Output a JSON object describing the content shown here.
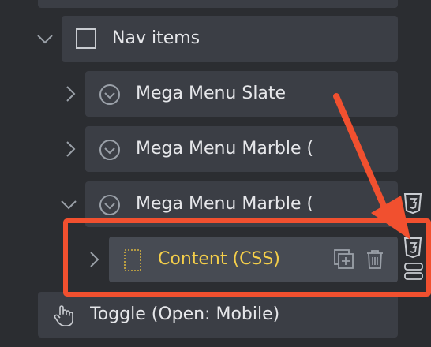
{
  "tree": {
    "nav_items": {
      "label": "Nav items"
    },
    "mega_menu_slate": {
      "label": "Mega Menu Slate"
    },
    "mega_menu_marble_1": {
      "label": "Mega Menu Marble ("
    },
    "mega_menu_marble_2": {
      "label": "Mega Menu Marble ("
    },
    "content_css": {
      "label": "Content (CSS)"
    },
    "toggle": {
      "label": "Toggle (Open: Mobile)"
    }
  },
  "colors": {
    "background": "#2b2d31",
    "row": "#3b3e45",
    "row_selected": "#474b53",
    "highlight_label": "#f5cf4a",
    "annotation": "#f1502f"
  },
  "icons": [
    "chevron-right-icon",
    "chevron-down-icon",
    "checkbox-icon",
    "circle-chevron-icon",
    "dotted-frame-icon",
    "duplicate-icon",
    "trash-icon",
    "css3-icon",
    "toggle-icon",
    "hand-pointer-icon"
  ]
}
